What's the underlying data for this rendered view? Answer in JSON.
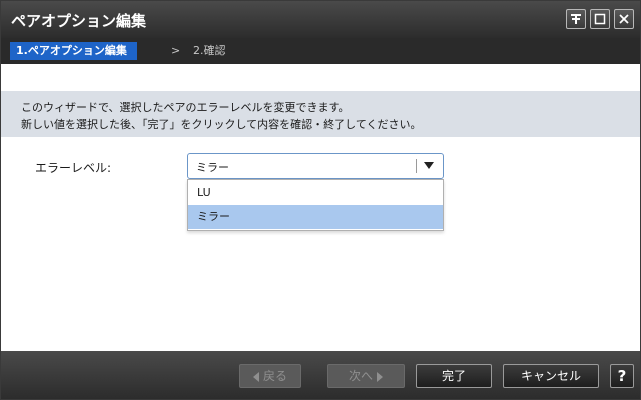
{
  "window": {
    "title": "ペアオプション編集",
    "controls": [
      "pin-icon",
      "maximize-icon",
      "close-icon"
    ]
  },
  "steps": {
    "active": "1.ペアオプション編集",
    "separator": ">",
    "next": "2.確認"
  },
  "info": {
    "line1": "このウィザードで、選択したペアのエラーレベルを変更できます。",
    "line2": "新しい値を選択した後、「完了」をクリックして内容を確認・終了してください。"
  },
  "form": {
    "error_level_label": "エラーレベル:",
    "selected_value": "ミラー",
    "options": [
      "LU",
      "ミラー"
    ],
    "highlighted_option": "ミラー"
  },
  "footer": {
    "back_label": "戻る",
    "next_label": "次へ",
    "finish_label": "完了",
    "cancel_label": "キャンセル",
    "help_label": "?"
  },
  "colors": {
    "titlebar": "#2c2c2c",
    "step_active": "#1e64c8",
    "infobar": "#dadfe6",
    "option_highlight": "#a9c8ee"
  }
}
